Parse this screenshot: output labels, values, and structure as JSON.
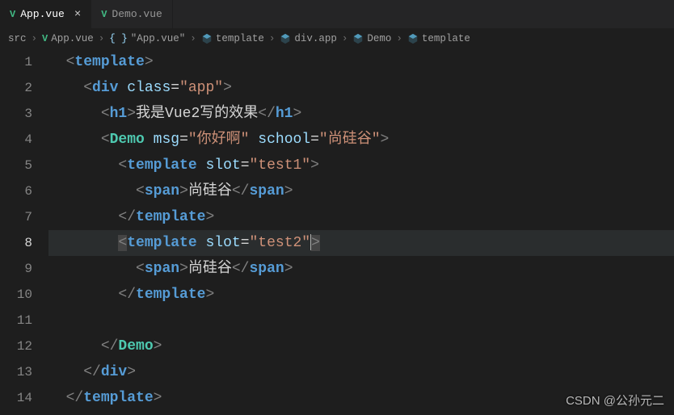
{
  "tabs": [
    {
      "label": "App.vue",
      "active": true
    },
    {
      "label": "Demo.vue",
      "active": false
    }
  ],
  "breadcrumbs": {
    "src": "src",
    "file": "App.vue",
    "string": "\"App.vue\"",
    "items": [
      "template",
      "div.app",
      "Demo",
      "template"
    ]
  },
  "code": {
    "current_line": 8,
    "template_open": "template",
    "template_close": "template",
    "div": "div",
    "class_attr": "class",
    "class_val": "\"app\"",
    "h1": "h1",
    "h1_text": "我是Vue2写的效果",
    "demo": "Demo",
    "msg_attr": "msg",
    "msg_val": "\"你好啊\"",
    "school_attr": "school",
    "school_val": "\"尚硅谷\"",
    "slot_attr": "slot",
    "slot1_val": "\"test1\"",
    "slot2_val": "\"test2\"",
    "span": "span",
    "span_text": "尚硅谷"
  },
  "watermark": "CSDN @公孙元二"
}
